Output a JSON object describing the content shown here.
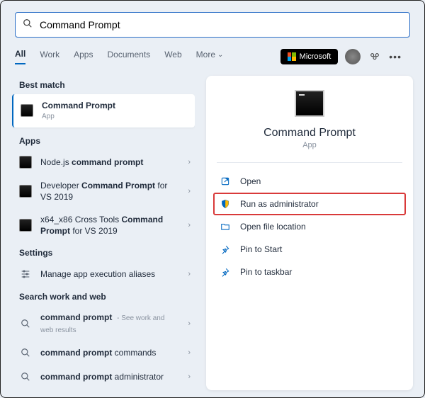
{
  "search": {
    "value": "Command Prompt"
  },
  "tabs": {
    "all": "All",
    "work": "Work",
    "apps": "Apps",
    "documents": "Documents",
    "web": "Web",
    "more": "More"
  },
  "microsoft_badge": "Microsoft",
  "sections": {
    "best_match": "Best match",
    "apps": "Apps",
    "settings": "Settings",
    "search_web": "Search work and web"
  },
  "best": {
    "title": "Command Prompt",
    "sub": "App"
  },
  "apps_list": [
    {
      "prefix": "Node.js ",
      "bold": "command prompt",
      "suffix": ""
    },
    {
      "prefix": "Developer ",
      "bold": "Command Prompt",
      "suffix": " for VS 2019"
    },
    {
      "prefix": "x64_x86 Cross Tools ",
      "bold": "Command Prompt",
      "suffix": " for VS 2019"
    }
  ],
  "settings_list": [
    {
      "label": "Manage app execution aliases"
    }
  ],
  "web_list": [
    {
      "bold": "command prompt",
      "suffix": "",
      "note": " - See work and web results"
    },
    {
      "bold": "command prompt ",
      "suffix": "commands",
      "note": ""
    },
    {
      "bold": "command prompt ",
      "suffix": "administrator",
      "note": ""
    }
  ],
  "preview": {
    "title": "Command Prompt",
    "sub": "App"
  },
  "actions": [
    {
      "key": "open",
      "label": "Open",
      "icon": "open"
    },
    {
      "key": "admin",
      "label": "Run as administrator",
      "icon": "shield",
      "highlight": true
    },
    {
      "key": "loc",
      "label": "Open file location",
      "icon": "folder"
    },
    {
      "key": "pinstart",
      "label": "Pin to Start",
      "icon": "pin"
    },
    {
      "key": "pintask",
      "label": "Pin to taskbar",
      "icon": "pin"
    }
  ]
}
